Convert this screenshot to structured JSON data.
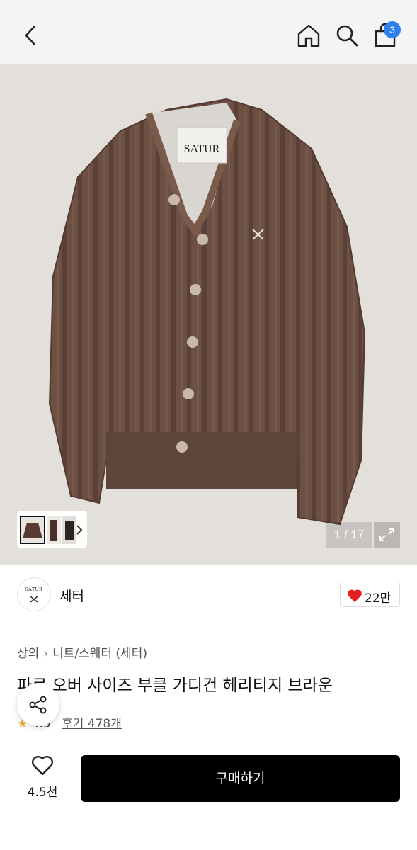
{
  "header": {
    "cart_count": "3",
    "icons": [
      "back-icon",
      "home-icon",
      "search-icon",
      "cart-icon"
    ]
  },
  "gallery": {
    "counter": "1 / 17",
    "image_brand_label": "SATUR"
  },
  "brand": {
    "logo_text": "SATUR",
    "name": "세터",
    "likes": "22만"
  },
  "breadcrumb": {
    "level1": "상의",
    "level2": "니트/스웨터 (세터)"
  },
  "product": {
    "title": "파로 오버 사이즈 부클 가디건 헤리티지 브라운",
    "rating": "4.9",
    "reviews": "후기 478개"
  },
  "bottom": {
    "wish_count": "4.5천",
    "buy_label": "구매하기"
  },
  "colors": {
    "accent_blue": "#2f80ed",
    "heart_red": "#e0201f",
    "star": "#f5a623",
    "cardigan": "#6b5043"
  }
}
